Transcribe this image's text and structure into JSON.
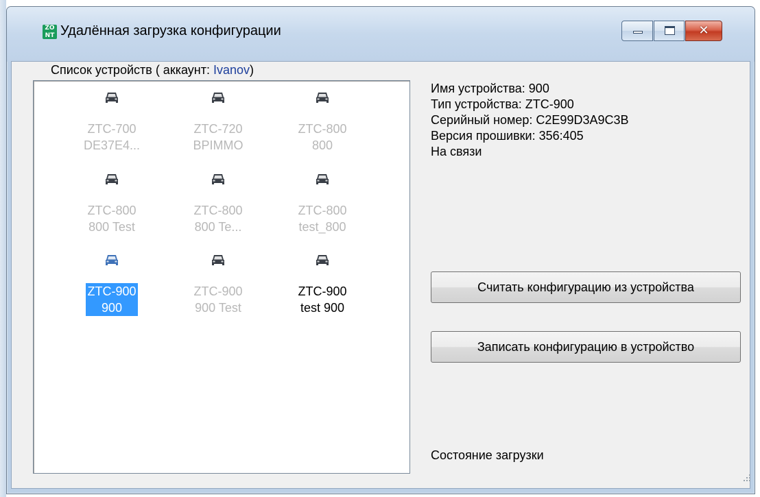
{
  "window": {
    "title": "Удалённая загрузка конфигурации",
    "app_icon": {
      "top": "ZO",
      "bottom": "NT"
    },
    "controls": {
      "minimize": "minimize-icon",
      "maximize": "maximize-icon",
      "close": "close-icon"
    }
  },
  "device_list": {
    "label": "Список устройств ( аккаунт:",
    "account": "Ivanov",
    "label_suffix": ")",
    "devices": [
      {
        "line1": "ZTC-700",
        "line2": "DE37E4...",
        "state": "offline"
      },
      {
        "line1": "ZTC-720",
        "line2": "BPIMMO",
        "state": "offline"
      },
      {
        "line1": "ZTC-800",
        "line2": "800",
        "state": "offline"
      },
      {
        "line1": "ZTC-800",
        "line2": "800 Test",
        "state": "offline"
      },
      {
        "line1": "ZTC-800",
        "line2": "800 Te...",
        "state": "offline"
      },
      {
        "line1": "ZTC-800",
        "line2": "test_800",
        "state": "offline"
      },
      {
        "line1": "ZTC-900",
        "line2": "900",
        "state": "selected"
      },
      {
        "line1": "ZTC-900",
        "line2": "900 Test",
        "state": "offline"
      },
      {
        "line1": "ZTC-900",
        "line2": "test 900",
        "state": "online"
      }
    ]
  },
  "info": {
    "name": "Имя устройства: 900",
    "type": "Тип устройства: ZTC-900",
    "serial": "Серийный номер: C2E99D3A9C3B",
    "firmware": "Версия прошивки: 356:405",
    "status": "На связи"
  },
  "buttons": {
    "read": "Считать конфигурацию из устройства",
    "write": "Записать конфигурацию в устройство"
  },
  "upload_status": "Состояние загрузки",
  "colors": {
    "selection": "#3399ff",
    "car_icon": "#3a3f47",
    "car_icon_selected": "#3f72b8",
    "offline_text": "#b8b8b8"
  }
}
